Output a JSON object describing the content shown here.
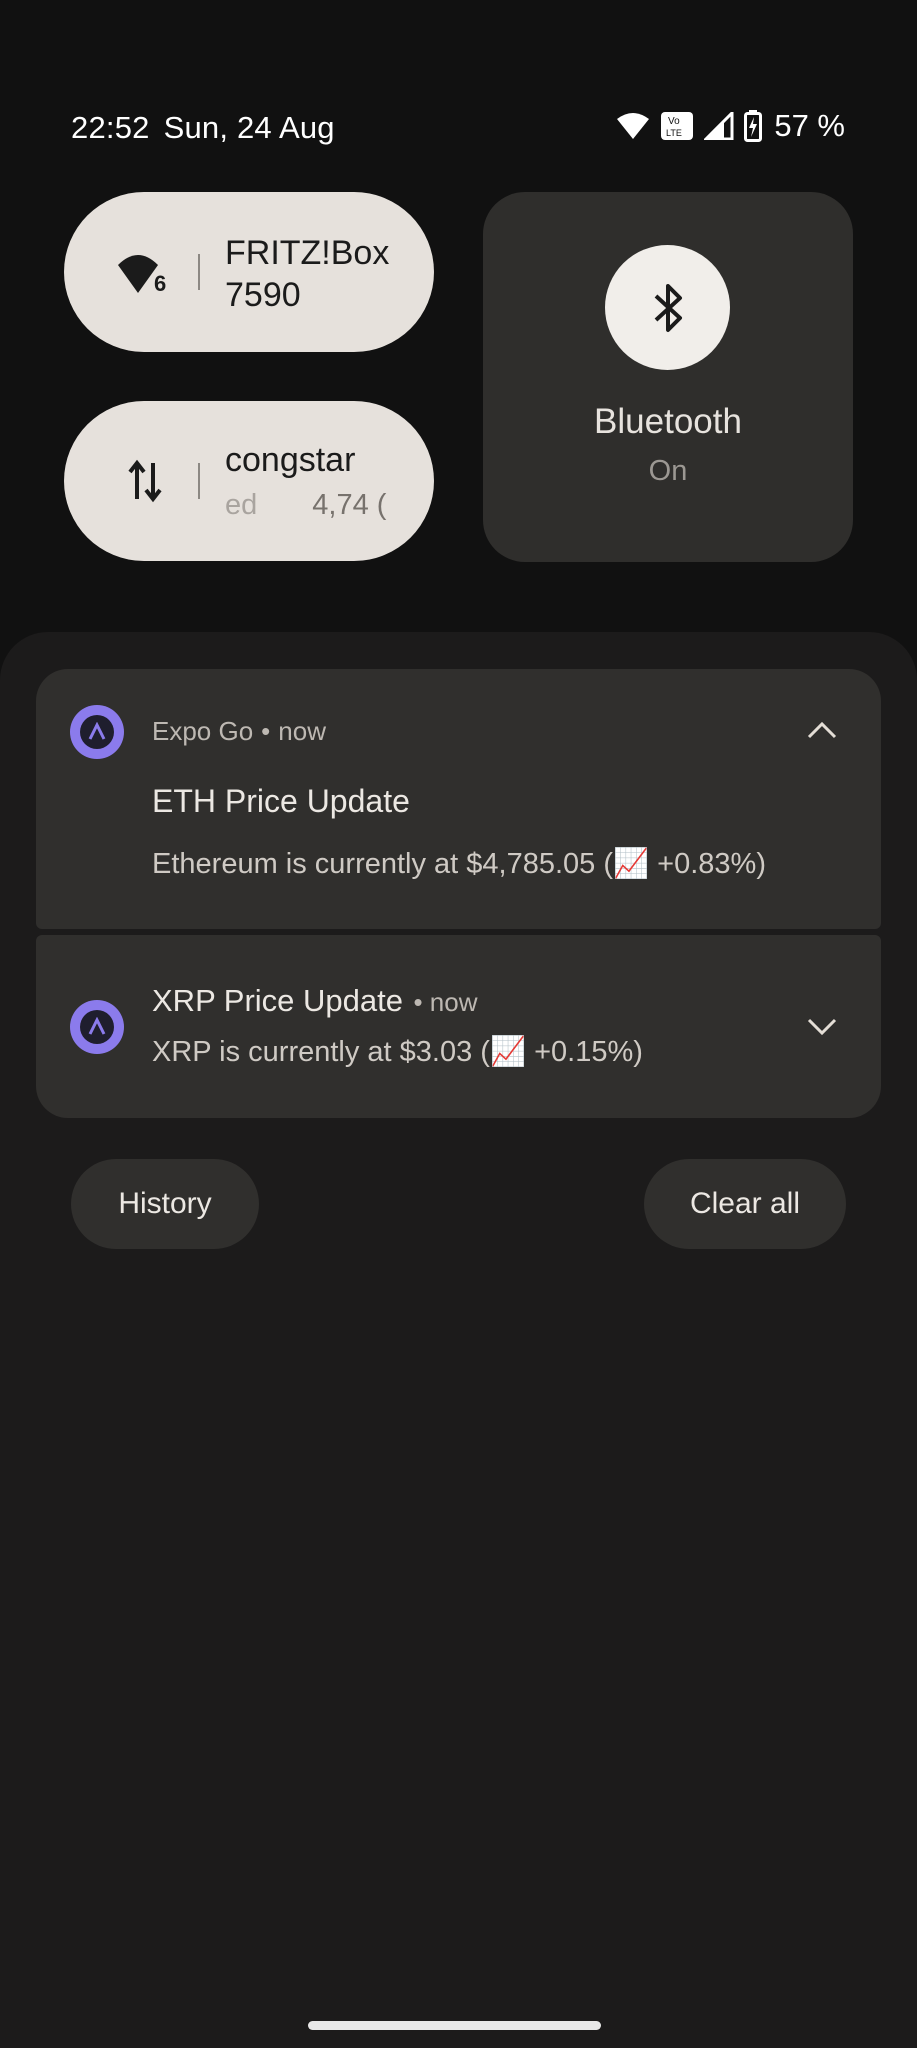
{
  "status_bar": {
    "time": "22:52",
    "date": "Sun, 24 Aug",
    "battery_percent": "57 %",
    "icons": [
      "wifi-icon",
      "volte-icon",
      "cell-signal-icon",
      "battery-charging-icon"
    ]
  },
  "quick_settings": {
    "wifi": {
      "title": "FRITZ!Box 7590",
      "icon": "wifi-6-icon"
    },
    "mobile_data": {
      "title": "congstar",
      "subtitle_left": "ed",
      "subtitle_right": "4,74 (",
      "icon": "data-arrows-icon"
    },
    "bluetooth": {
      "label": "Bluetooth",
      "state": "On",
      "icon": "bluetooth-icon"
    }
  },
  "notifications": [
    {
      "app": "Expo Go",
      "separator": "•",
      "time": "now",
      "title": "ETH Price Update",
      "body": "Ethereum is currently at $4,785.05 (📈 +0.83%)",
      "expanded": true
    },
    {
      "title": "XRP Price Update",
      "separator": "•",
      "time": "now",
      "body": "XRP is currently at $3.03 (📈 +0.15%)",
      "expanded": false
    }
  ],
  "actions": {
    "history_label": "History",
    "clear_all_label": "Clear all"
  },
  "colors": {
    "accent_app_icon": "#8b7bec",
    "tile_light": "#e6e1dc",
    "shade_bg": "#1c1b1b",
    "card_bg": "#302f2d"
  }
}
